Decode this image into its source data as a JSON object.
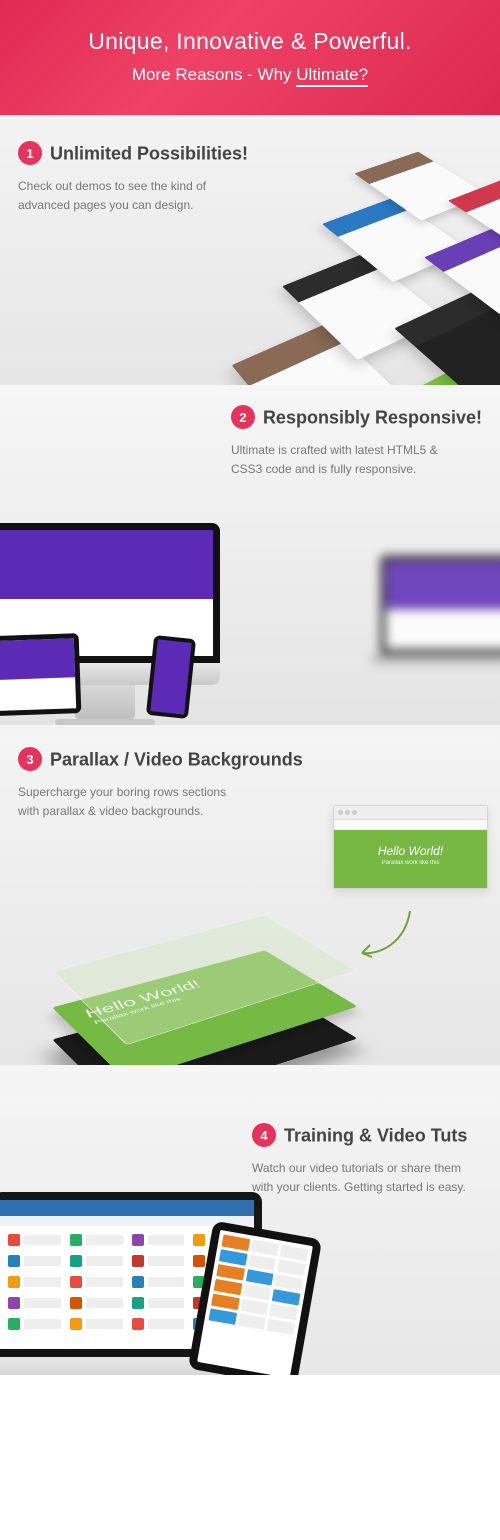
{
  "hero": {
    "line1": "Unique, Innovative & Powerful.",
    "line2_pre": "More Reasons - Why ",
    "line2_highlight": "Ultimate?"
  },
  "sections": [
    {
      "num": "1",
      "title": "Unlimited Possibilities!",
      "desc": "Check out demos to see the kind of advanced pages you can design."
    },
    {
      "num": "2",
      "title": "Responsibly Responsive!",
      "desc": "Ultimate is crafted with latest HTML5 & CSS3 code and is fully responsive."
    },
    {
      "num": "3",
      "title": "Parallax / Video Backgrounds",
      "desc": "Supercharge your boring rows sections with parallax & video backgrounds.",
      "browser_title": "Hello World!",
      "browser_sub": "Parallax work like this",
      "layer_title": "Hello World!",
      "layer_sub": "Parallax work like this"
    },
    {
      "num": "4",
      "title": "Training & Video Tuts",
      "desc": "Watch our video tutorials or share them with your clients. Getting started is easy."
    }
  ],
  "colors": {
    "accent": "#e5335c",
    "purple": "#5c2bb5",
    "green": "#77b945"
  }
}
